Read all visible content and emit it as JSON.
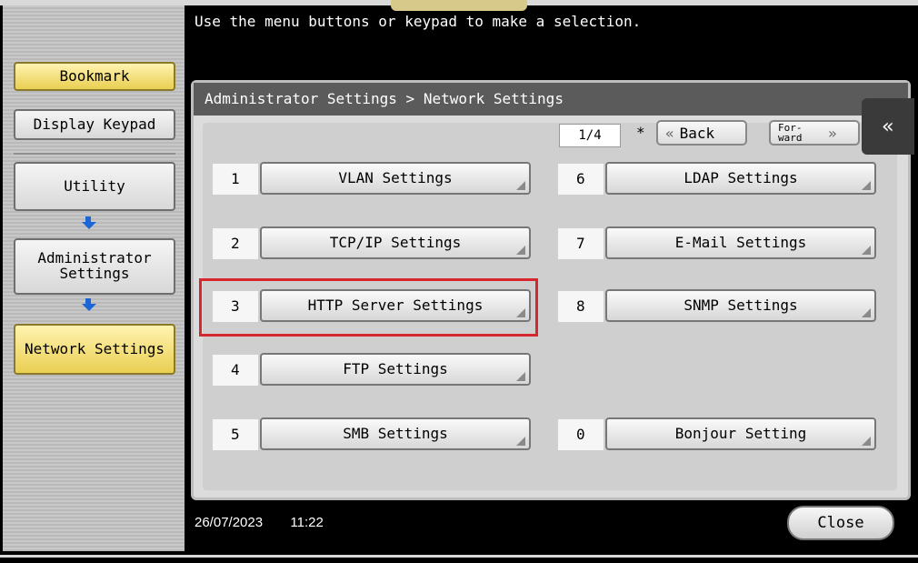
{
  "message": "Use the menu buttons or keypad to make a selection.",
  "left_panel": {
    "bookmark": "Bookmark",
    "display_keypad": "Display Keypad",
    "nav": [
      "Utility",
      "Administrator Settings",
      "Network Settings"
    ]
  },
  "breadcrumb": "Administrator Settings > Network Settings",
  "pager": {
    "page": "1/4",
    "star": "*",
    "back_label": "Back",
    "forward_label": "For-ward"
  },
  "items": [
    {
      "number": "1",
      "label": "VLAN Settings"
    },
    {
      "number": "2",
      "label": "TCP/IP Settings"
    },
    {
      "number": "3",
      "label": "HTTP Server Settings"
    },
    {
      "number": "4",
      "label": "FTP Settings"
    },
    {
      "number": "5",
      "label": "SMB Settings"
    },
    {
      "number": "6",
      "label": "LDAP Settings"
    },
    {
      "number": "7",
      "label": "E-Mail Settings"
    },
    {
      "number": "8",
      "label": "SNMP Settings"
    },
    {
      "number": "0",
      "label": "Bonjour Setting"
    }
  ],
  "footer": {
    "date": "26/07/2023",
    "time": "11:22",
    "close_label": "Close"
  },
  "colors": {
    "highlight": "#d6262e",
    "accent_yellow": "#e9cf52",
    "arrow_blue": "#1d66d6"
  }
}
